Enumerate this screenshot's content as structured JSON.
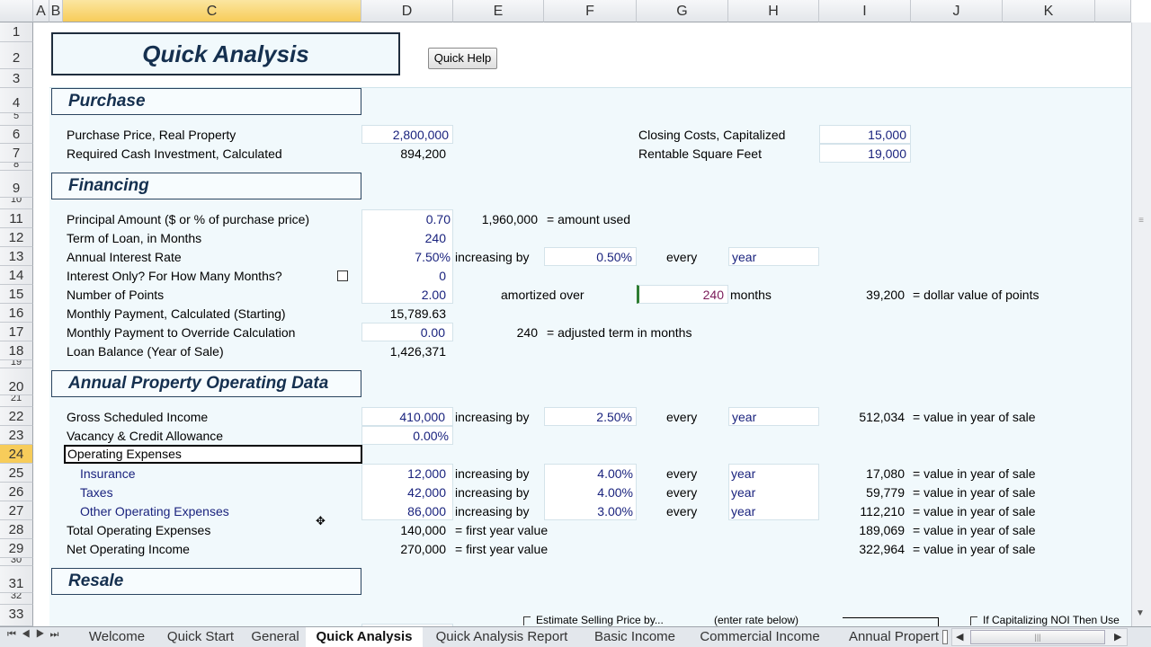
{
  "columns": [
    "A",
    "B",
    "C",
    "D",
    "E",
    "F",
    "G",
    "H",
    "I",
    "J",
    "K"
  ],
  "rows": [
    "1",
    "2",
    "3",
    "4",
    "5",
    "6",
    "7",
    "8",
    "9",
    "10",
    "11",
    "12",
    "13",
    "14",
    "15",
    "16",
    "17",
    "18",
    "19",
    "20",
    "21",
    "22",
    "23",
    "24",
    "25",
    "26",
    "27",
    "28",
    "29",
    "30",
    "31",
    "32",
    "33"
  ],
  "selected_cell": "C24",
  "title": "Quick Analysis",
  "quick_help": "Quick Help",
  "sections": {
    "purchase": "Purchase",
    "financing": "Financing",
    "operating": "Annual Property Operating Data",
    "resale": "Resale"
  },
  "purchase": {
    "price_label": "Purchase Price, Real Property",
    "price": "2,800,000",
    "cash_label": "Required Cash Investment, Calculated",
    "cash": "894,200",
    "closing_label": "Closing Costs, Capitalized",
    "closing": "15,000",
    "sqft_label": "Rentable Square Feet",
    "sqft": "19,000"
  },
  "financing": {
    "principal_label": "Principal Amount ($ or % of purchase price)",
    "principal": "0.70",
    "principal_used": "1,960,000",
    "principal_used_note": "= amount used",
    "term_label": "Term of Loan, in Months",
    "term": "240",
    "rate_label": "Annual Interest Rate",
    "rate": "7.50%",
    "rate_inc_label": "increasing by",
    "rate_inc": "0.50%",
    "every": "every",
    "rate_period": "year",
    "io_label": "Interest Only?  For How Many Months?",
    "io_checked": false,
    "io_months": "0",
    "points_label": "Number of Points",
    "points": "2.00",
    "amort_label": "amortized over",
    "amort": "240",
    "months": "months",
    "points_value": "39,200",
    "points_note": "= dollar value of points",
    "payment_label": "Monthly Payment, Calculated (Starting)",
    "payment": "15,789.63",
    "override_label": "Monthly Payment to Override Calculation",
    "override": "0.00",
    "adj_term": "240",
    "adj_term_note": "= adjusted term in months",
    "balance_label": "Loan Balance (Year of Sale)",
    "balance": "1,426,371"
  },
  "operating": {
    "gsi_label": "Gross Scheduled Income",
    "gsi": "410,000",
    "gsi_inc": "2.50%",
    "gsi_sale": "512,034",
    "vacancy_label": "Vacancy & Credit Allowance",
    "vacancy": "0.00%",
    "opex_label": "Operating Expenses",
    "increasing_by": "increasing by",
    "every": "every",
    "year": "year",
    "sale_note": "= value in year of sale",
    "first_year": "= first year value",
    "items": [
      {
        "label": "Insurance",
        "value": "12,000",
        "inc": "4.00%",
        "sale": "17,080"
      },
      {
        "label": "Taxes",
        "value": "42,000",
        "inc": "4.00%",
        "sale": "59,779"
      },
      {
        "label": "Other Operating Expenses",
        "value": "86,000",
        "inc": "3.00%",
        "sale": "112,210"
      }
    ],
    "total_label": "Total Operating Expenses",
    "total": "140,000",
    "total_sale": "189,069",
    "noi_label": "Net Operating Income",
    "noi": "270,000",
    "noi_sale": "322,964"
  },
  "resale": {
    "estimate_label": "Estimate  Selling Price by...",
    "enter_rate": "(enter rate below)",
    "cap_label": "If Capitalizing  NOI  Then  Use"
  },
  "tabs": [
    "Welcome",
    "Quick Start",
    "General",
    "Quick Analysis",
    "Quick Analysis Report",
    "Basic Income",
    "Commercial Income",
    "Annual Propert"
  ],
  "active_tab": "Quick Analysis",
  "colors": {
    "label_blue": "#1a237e",
    "section_text": "#15304f",
    "sheet_bg": "#f1f9fc",
    "selected_header": "#f7cc5a"
  }
}
